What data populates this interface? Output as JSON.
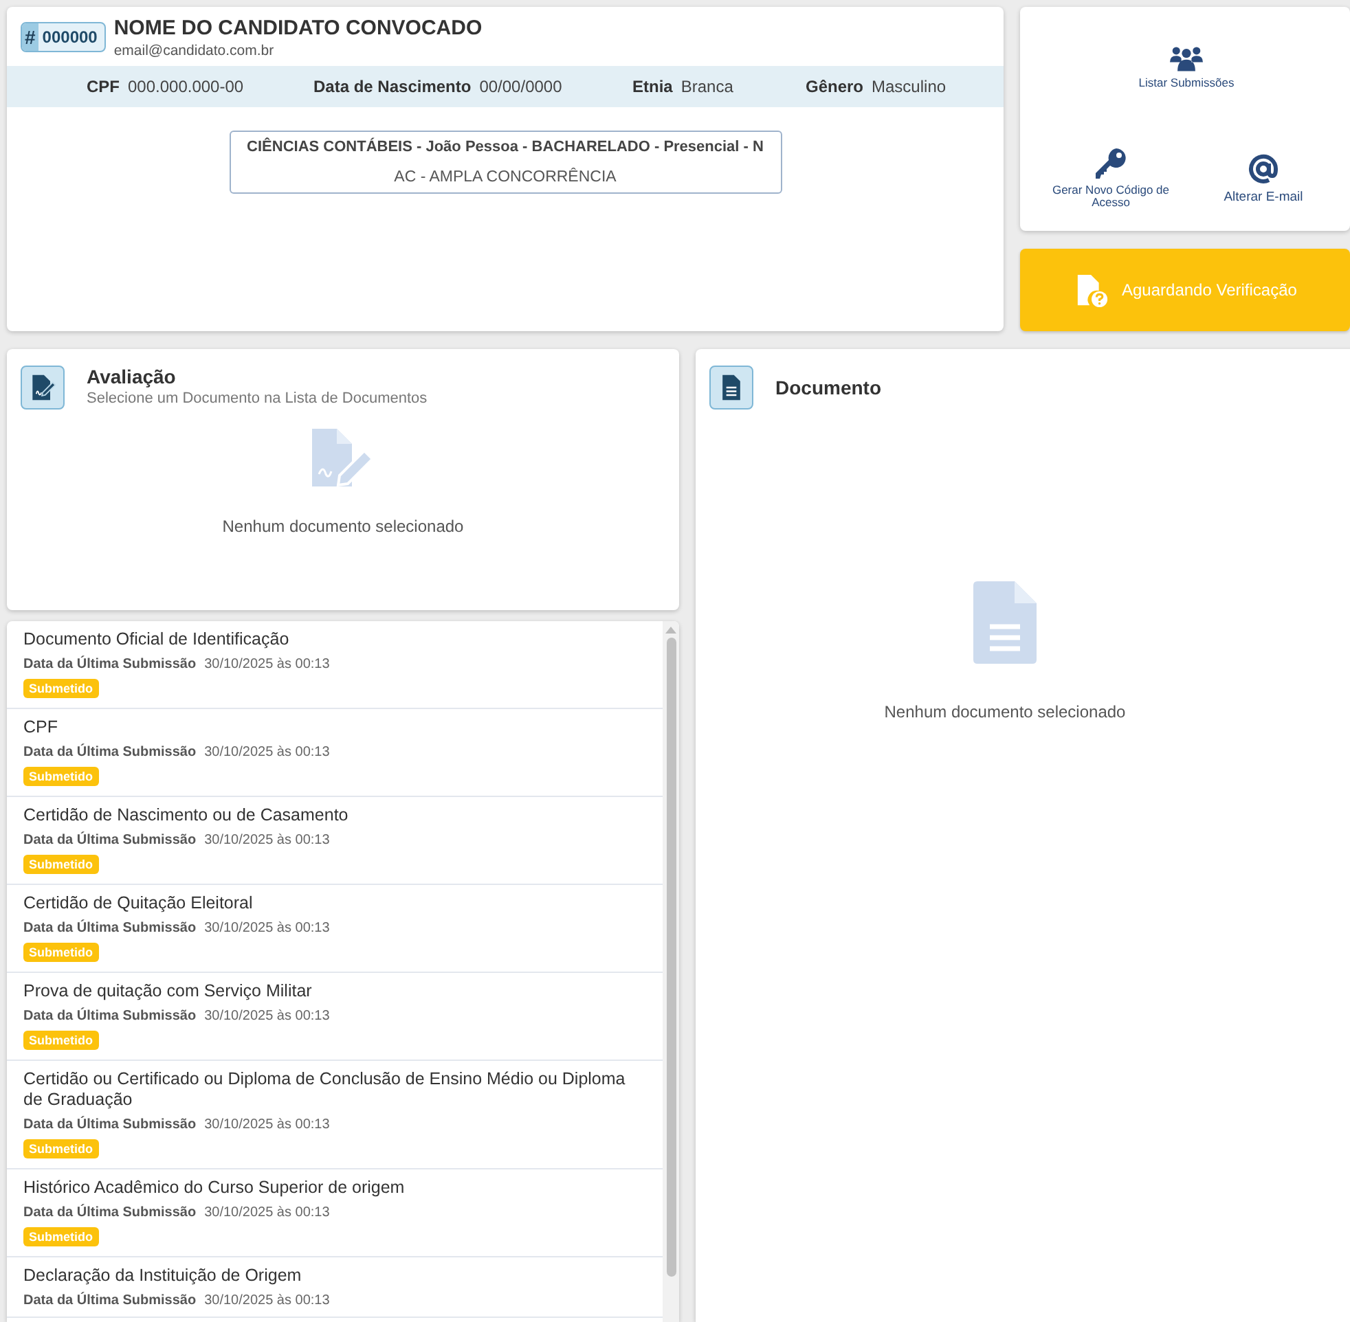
{
  "candidate": {
    "badge_symbol": "#",
    "code": "000000",
    "name": "NOME DO CANDIDATO CONVOCADO",
    "email": "email@candidato.com.br"
  },
  "info": [
    {
      "label": "CPF",
      "value": "000.000.000-00"
    },
    {
      "label": "Data de Nascimento",
      "value": "00/00/0000"
    },
    {
      "label": "Etnia",
      "value": "Branca"
    },
    {
      "label": "Gênero",
      "value": "Masculino"
    }
  ],
  "course": {
    "title": "CIÊNCIAS CONTÁBEIS - João Pessoa - BACHARELADO - Presencial - N",
    "quota": "AC - AMPLA CONCORRÊNCIA"
  },
  "actions": [
    {
      "kind": "users",
      "label": "Listar Submissões"
    },
    {
      "kind": "key",
      "label": "Gerar Novo Código de Acesso"
    },
    {
      "kind": "at",
      "label": "Alterar E-mail"
    }
  ],
  "status_button": {
    "label": "Aguardando Verificação"
  },
  "evaluation": {
    "title": "Avaliação",
    "subtitle": "Selecione um Documento na Lista de Documentos",
    "empty": "Nenhum documento selecionado"
  },
  "documents": [
    {
      "title": "Documento Oficial de Identificação",
      "date_label": "Data da Última Submissão",
      "date": "30/10/2025 às 00:13",
      "status": "Submetido"
    },
    {
      "title": "CPF",
      "date_label": "Data da Última Submissão",
      "date": "30/10/2025 às 00:13",
      "status": "Submetido"
    },
    {
      "title": "Certidão de Nascimento ou de Casamento",
      "date_label": "Data da Última Submissão",
      "date": "30/10/2025 às 00:13",
      "status": "Submetido"
    },
    {
      "title": "Certidão de Quitação Eleitoral",
      "date_label": "Data da Última Submissão",
      "date": "30/10/2025 às 00:13",
      "status": "Submetido"
    },
    {
      "title": "Prova de quitação com Serviço Militar",
      "date_label": "Data da Última Submissão",
      "date": "30/10/2025 às 00:13",
      "status": "Submetido"
    },
    {
      "title": "Certidão ou Certificado ou Diploma de Conclusão de Ensino Médio ou Diploma de Graduação",
      "date_label": "Data da Última Submissão",
      "date": "30/10/2025 às 00:13",
      "status": "Submetido"
    },
    {
      "title": "Histórico Acadêmico do Curso Superior de origem",
      "date_label": "Data da Última Submissão",
      "date": "30/10/2025 às 00:13",
      "status": "Submetido"
    },
    {
      "title": "Declaração da Instituição de Origem",
      "date_label": "Data da Última Submissão",
      "date": "30/10/2025 às 00:13"
    }
  ],
  "document_panel": {
    "title": "Documento",
    "empty": "Nenhum documento selecionado"
  }
}
